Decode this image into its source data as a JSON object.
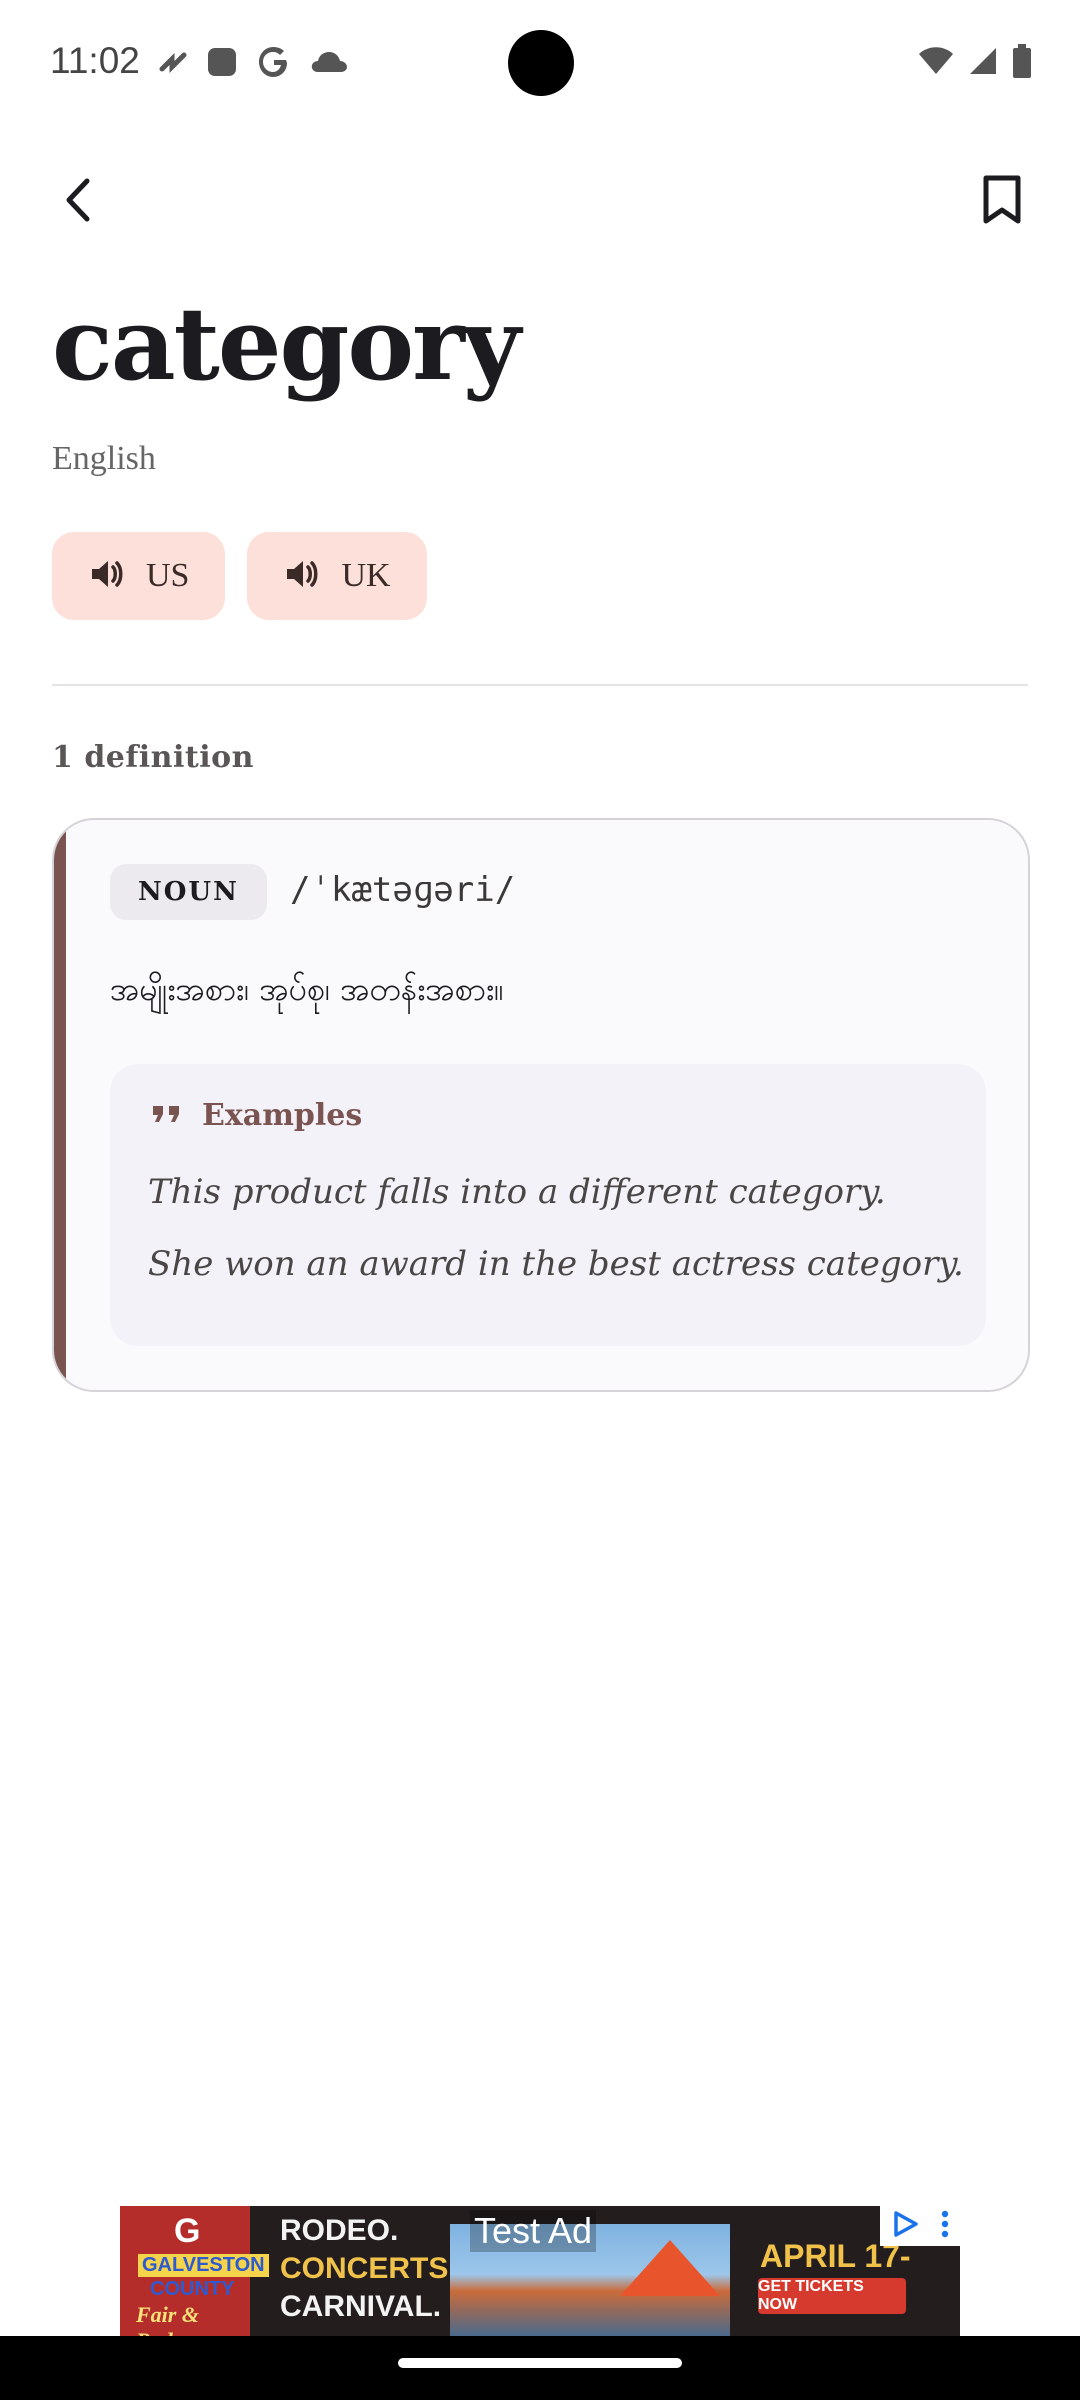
{
  "status_bar": {
    "time": "11:02",
    "icons_left": [
      "app-notification-icon",
      "square-icon",
      "google-icon",
      "cloud-icon"
    ],
    "icons_right": [
      "wifi-icon",
      "signal-icon",
      "battery-icon"
    ]
  },
  "header": {
    "back_icon": "back-arrow-icon",
    "bookmark_icon": "bookmark-icon"
  },
  "entry": {
    "word": "category",
    "language": "English",
    "pronunciations": [
      {
        "label": "US",
        "icon": "speaker-icon"
      },
      {
        "label": "UK",
        "icon": "speaker-icon"
      }
    ],
    "definition_count": "1 definition"
  },
  "definition_card": {
    "part_of_speech": "NOUN",
    "ipa": "/ˈkætəɡəri/",
    "meaning": "အမျိုးအစား၊ အုပ်စု၊ အတန်းအစား။",
    "examples_heading": "Examples",
    "examples": [
      "This product falls into a different category.",
      "She won an award in the best actress category."
    ]
  },
  "ad": {
    "label": "Test Ad",
    "logo_letter": "G",
    "logo_line1": "GALVESTON",
    "logo_line2": "COUNTY",
    "logo_line3": "Fair & Rodeo",
    "lines": [
      "RODEO.",
      "CONCERTS.",
      "CARNIVAL."
    ],
    "date": "APRIL 17-",
    "cta": "GET TICKETS NOW"
  },
  "colors": {
    "accent": "#7a5450",
    "pron_bg": "#fde0d9",
    "card_bg": "#fafafd"
  }
}
